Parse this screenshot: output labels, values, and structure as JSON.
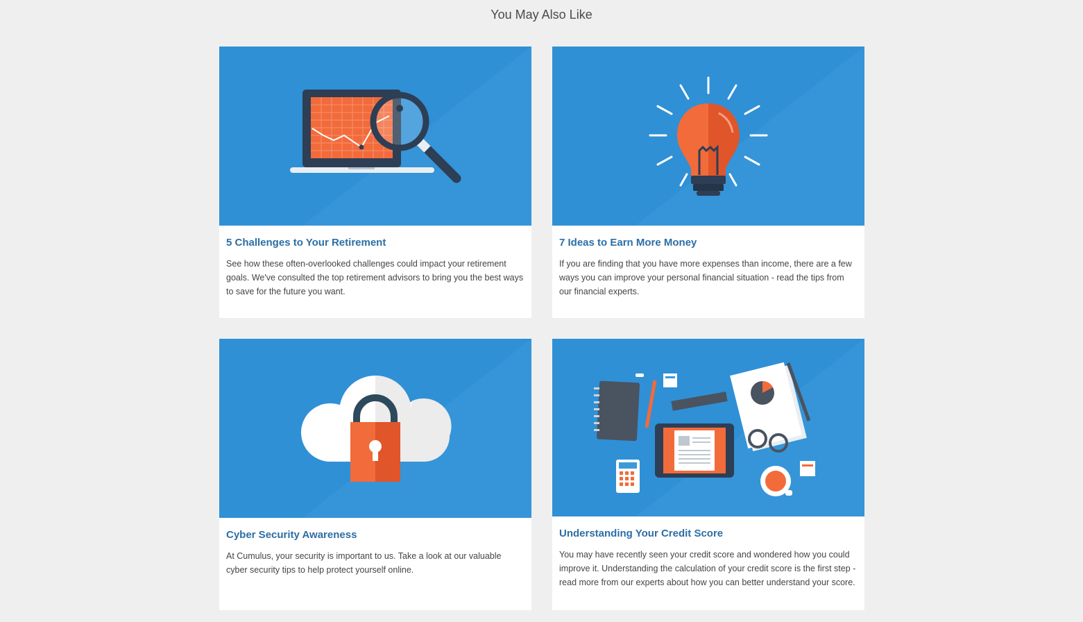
{
  "section": {
    "title": "You May Also Like"
  },
  "cards": [
    {
      "title": "5 Challenges to Your Retirement",
      "description": "See how these often-overlooked challenges could impact your retirement goals. We've consulted the top retirement advisors to bring you the best ways to save for the future you want.",
      "image_icon": "laptop-chart-magnifier-icon"
    },
    {
      "title": "7 Ideas to Earn More Money",
      "description": "If you are finding that you have more expenses than income, there are a few ways you can improve your personal financial situation - read the tips from our financial experts.",
      "image_icon": "lightbulb-icon"
    },
    {
      "title": "Cyber Security Awareness",
      "description": "At Cumulus, your security is important to us. Take a look at our valuable cyber security tips to help protect yourself online.",
      "image_icon": "cloud-lock-icon"
    },
    {
      "title": "Understanding Your Credit Score",
      "description": "You may have recently seen your credit score and wondered how you could improve it. Understanding the calculation of your credit score is the first step - read more from our experts about how you can better understand your score.",
      "image_icon": "desk-items-icon"
    }
  ],
  "colors": {
    "page_background": "#efefef",
    "image_background": "#2f90d6",
    "title_link": "#2c6ea5",
    "accent_orange": "#f26b3a"
  }
}
